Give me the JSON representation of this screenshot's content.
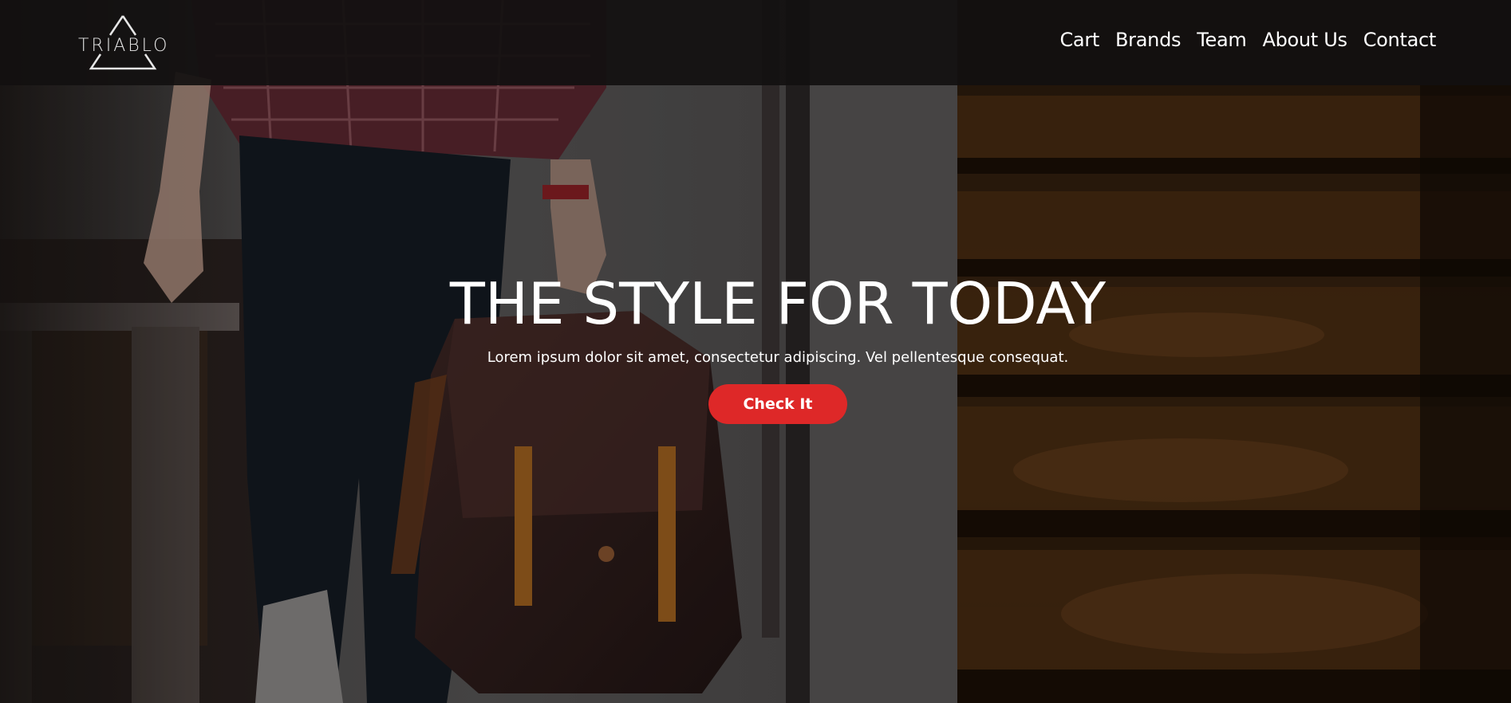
{
  "brand": {
    "logo_text": "TRIABLO"
  },
  "nav": {
    "items": [
      {
        "label": "Cart"
      },
      {
        "label": "Brands"
      },
      {
        "label": "Team"
      },
      {
        "label": "About Us"
      },
      {
        "label": "Contact"
      }
    ]
  },
  "hero": {
    "title": "THE STYLE FOR TODAY",
    "subtitle": "Lorem ipsum dolor sit amet, consectetur adipiscing. Vel pellentesque consequat.",
    "cta_label": "Check It"
  },
  "colors": {
    "accent": "#de2828",
    "navbar_bg": "#121010",
    "text": "#ffffff"
  }
}
